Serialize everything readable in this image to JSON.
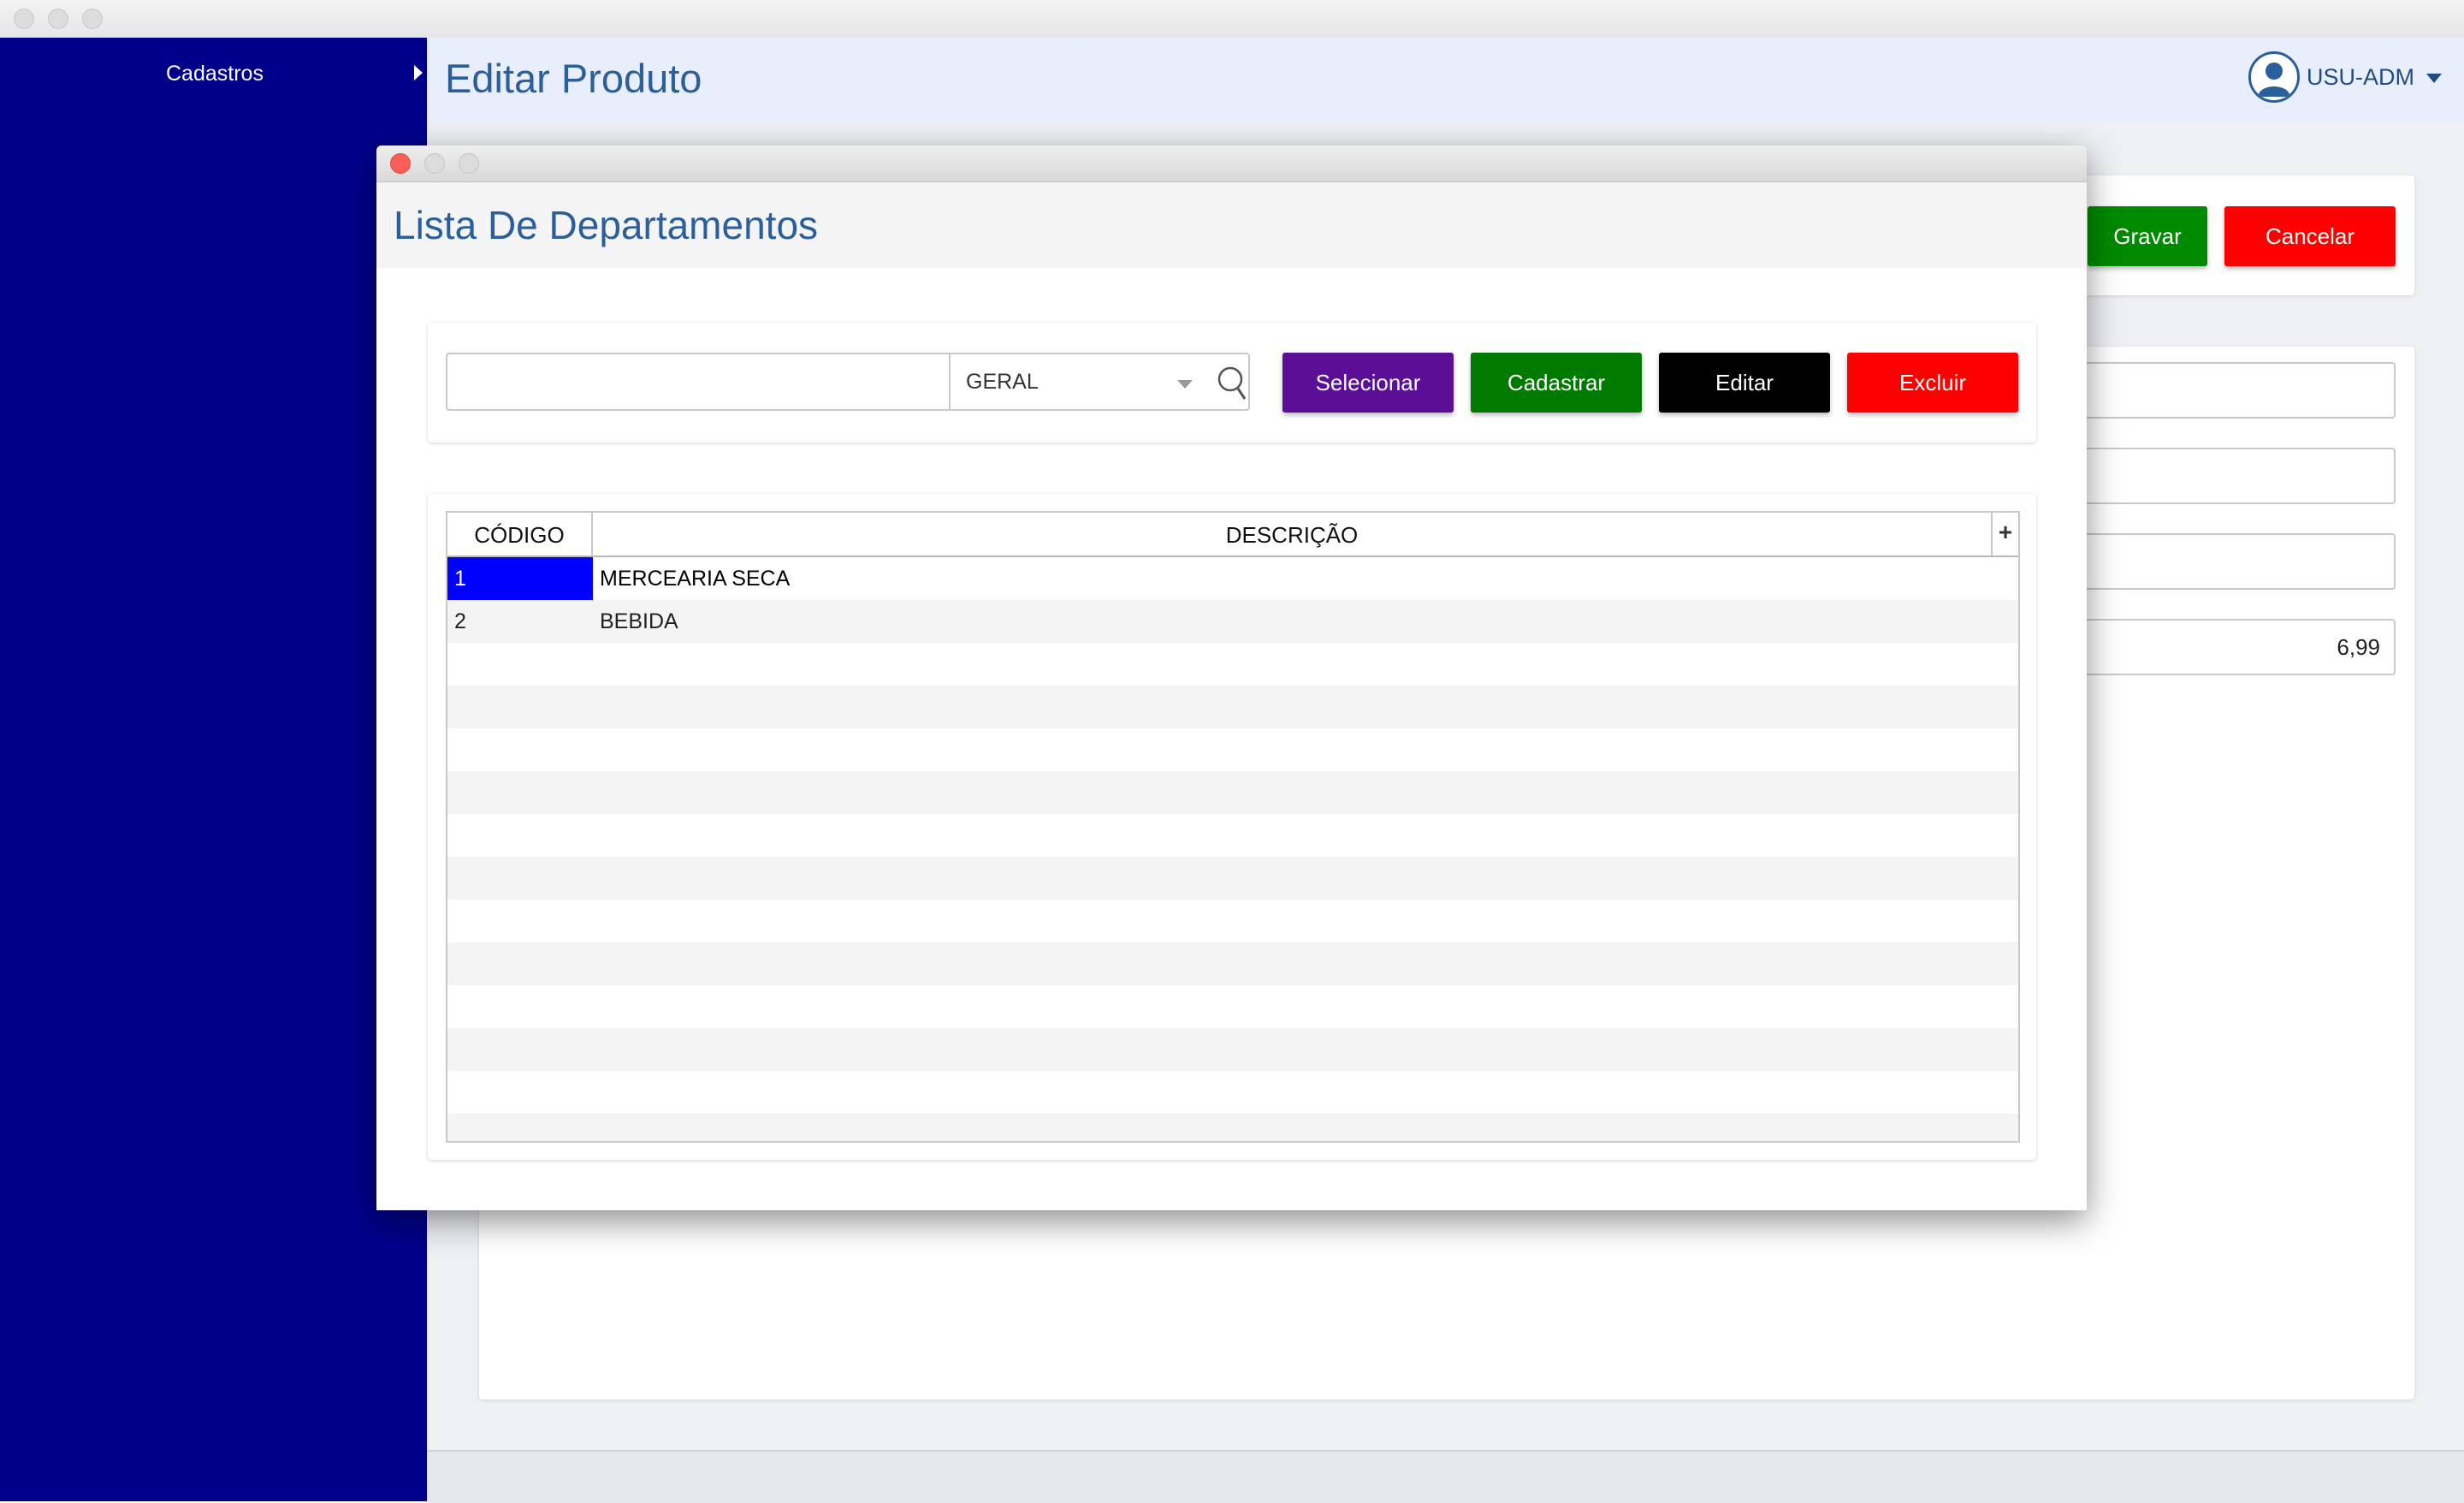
{
  "sidebar": {
    "items": [
      {
        "label": "Cadastros"
      }
    ]
  },
  "header": {
    "title": "Editar Produto",
    "user": "USU-ADM"
  },
  "background_form": {
    "buttons": {
      "save": "Gravar",
      "cancel": "Cancelar"
    },
    "price_value": "6,99"
  },
  "modal": {
    "title": "Lista De Departamentos",
    "search": {
      "value": "",
      "placeholder": ""
    },
    "filter": {
      "selected": "GERAL"
    },
    "buttons": {
      "select": "Selecionar",
      "register": "Cadastrar",
      "edit": "Editar",
      "delete": "Excluir"
    },
    "table": {
      "columns": [
        "CÓDIGO",
        "DESCRIÇÃO"
      ],
      "add_column": "+",
      "rows": [
        {
          "code": "1",
          "description": "MERCEARIA SECA",
          "selected": true
        },
        {
          "code": "2",
          "description": "BEBIDA",
          "selected": false
        }
      ]
    }
  },
  "colors": {
    "sidebar": "#00008b",
    "title": "#2a5f9c",
    "select_button": "#5b0f96",
    "register_button": "#007a00",
    "edit_button": "#000000",
    "delete_button": "#ff0000",
    "save_button": "#008a00",
    "cancel_button": "#ff0000",
    "selected_cell": "#0000ff"
  }
}
